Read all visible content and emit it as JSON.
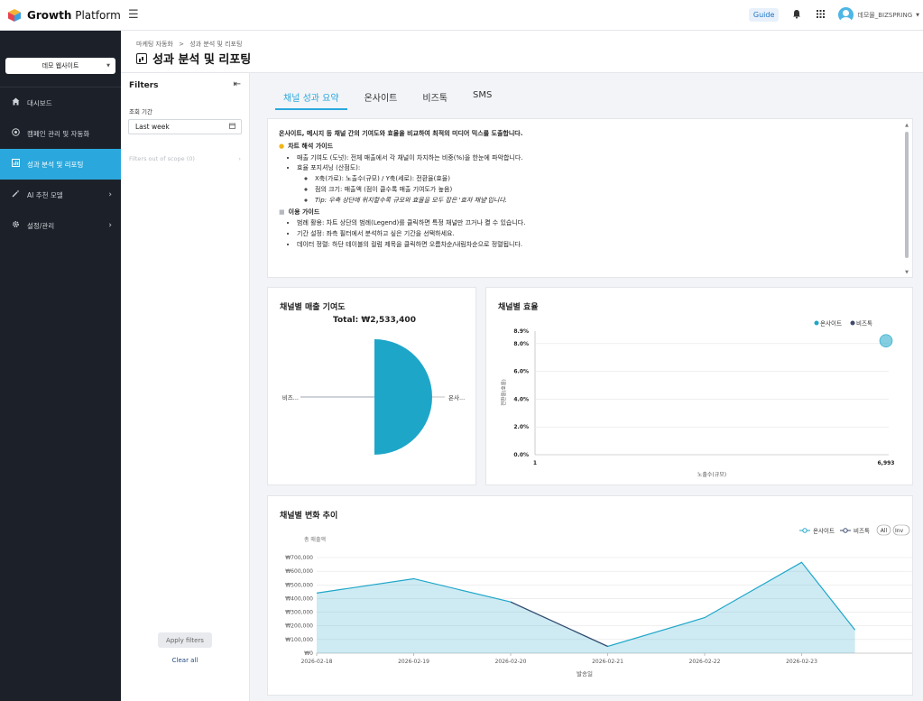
{
  "app": {
    "brand_bold": "Growth",
    "brand_light": " Platform"
  },
  "topbar": {
    "guide_label": "Guide",
    "user_name": "데모몰_BIZSPRING"
  },
  "sidebar": {
    "site_select": "데모 웹사이트",
    "items": [
      {
        "label": "대시보드",
        "icon": "home-icon"
      },
      {
        "label": "캠페인 관리 및 자동화",
        "icon": "target-icon"
      },
      {
        "label": "성과 분석 및 리포팅",
        "icon": "chart-icon",
        "active": true
      },
      {
        "label": "AI 추천 모델",
        "icon": "magic-wand-icon"
      },
      {
        "label": "설정/관리",
        "icon": "gear-icon"
      }
    ]
  },
  "header": {
    "breadcrumb_1": "마케팅 자동화",
    "breadcrumb_sep": ">",
    "breadcrumb_2": "성과 분석 및 리포팅",
    "title": "성과 분석 및 리포팅"
  },
  "filters": {
    "title": "Filters",
    "period_label": "조회 기간",
    "period_value": "Last week",
    "out_of_scope": "Filters out of scope (0)",
    "apply_label": "Apply filters",
    "clear_label": "Clear all"
  },
  "tabs": [
    "채널 성과 요약",
    "온사이트",
    "비즈톡",
    "SMS"
  ],
  "description": {
    "lead": "온사이트, 메시지 등 채널 간의 기여도와 효율을 비교하여 최적의 미디어 믹스를 도출합니다.",
    "section1_title": "차트 해석 가이드",
    "s1_item1": "매출 기여도 (도넛): 전체 매출에서 각 채널이 차지하는 비중(%)을 한눈에 파악합니다.",
    "s1_item2": "효율 포지셔닝 (산점도):",
    "s1_sub1": "X축(가로): 노출수(규모) / Y축(세로): 전환율(효율)",
    "s1_sub2": "점의 크기: 매출액 (점이 클수록 매출 기여도가 높음)",
    "s1_sub3": "Tip: 우측 상단에 위치할수록 규모와 효율을 모두 잡은 '효자 채널'입니다.",
    "section2_title": "이용 가이드",
    "s2_item1": "범례 활용: 차트 상단의 범례(Legend)를 클릭하면 특정 채널만 끄거나 켤 수 있습니다.",
    "s2_item2": "기간 설정: 좌측 필터에서 분석하고 싶은 기간을 선택하세요.",
    "s2_item3": "데이터 정렬: 하단 테이블의 컬럼 제목을 클릭하면 오름차순/내림차순으로 정렬됩니다."
  },
  "chart_data": [
    {
      "type": "pie",
      "title": "채널별 매출 기여도",
      "subtitle": "Total: ₩2,533,400",
      "labels": [
        "온사...",
        "비즈..."
      ],
      "values": [
        2533400,
        0
      ],
      "colors": [
        "#1ea6c9",
        "#3d4a6b"
      ]
    },
    {
      "type": "scatter",
      "title": "채널별 효율",
      "xlabel": "노출수(규모)",
      "ylabel": "전환율(효율)",
      "x_ticks": [
        "1",
        "6,993"
      ],
      "y_ticks": [
        "0.0%",
        "2.0%",
        "4.0%",
        "6.0%",
        "8.0%",
        "8.9%"
      ],
      "ylim": [
        0,
        8.9
      ],
      "legend": [
        "온사이트",
        "비즈톡"
      ],
      "legend_position": "top-right",
      "colors": [
        "#1ea6c9",
        "#3d4a6b"
      ],
      "points": [
        {
          "series": "온사이트",
          "x": 6993,
          "y": 8.2
        }
      ]
    },
    {
      "type": "area",
      "title": "채널별 변화 추이",
      "ylabel": "총 매출액",
      "xlabel": "발송일",
      "categories": [
        "2026-02-18",
        "2026-02-19",
        "2026-02-20",
        "2026-02-21",
        "2026-02-22",
        "2026-02-23"
      ],
      "y_ticks": [
        "₩0",
        "₩100,000",
        "₩200,000",
        "₩300,000",
        "₩400,000",
        "₩500,000",
        "₩600,000",
        "₩700,000"
      ],
      "ylim": [
        0,
        700000
      ],
      "legend": [
        "온사이트",
        "비즈톡"
      ],
      "legend_buttons": [
        "All",
        "Inv"
      ],
      "legend_position": "top-right",
      "colors": [
        "#1ea6c9",
        "#3d4a6b"
      ],
      "series": [
        {
          "name": "온사이트",
          "x": [
            0,
            1,
            2,
            3,
            4,
            5,
            5.55
          ],
          "values": [
            440000,
            545000,
            375000,
            50000,
            260000,
            665000,
            170000
          ]
        },
        {
          "name": "비즈톡",
          "x": [
            2,
            3
          ],
          "values": [
            375000,
            50000
          ]
        }
      ]
    }
  ]
}
